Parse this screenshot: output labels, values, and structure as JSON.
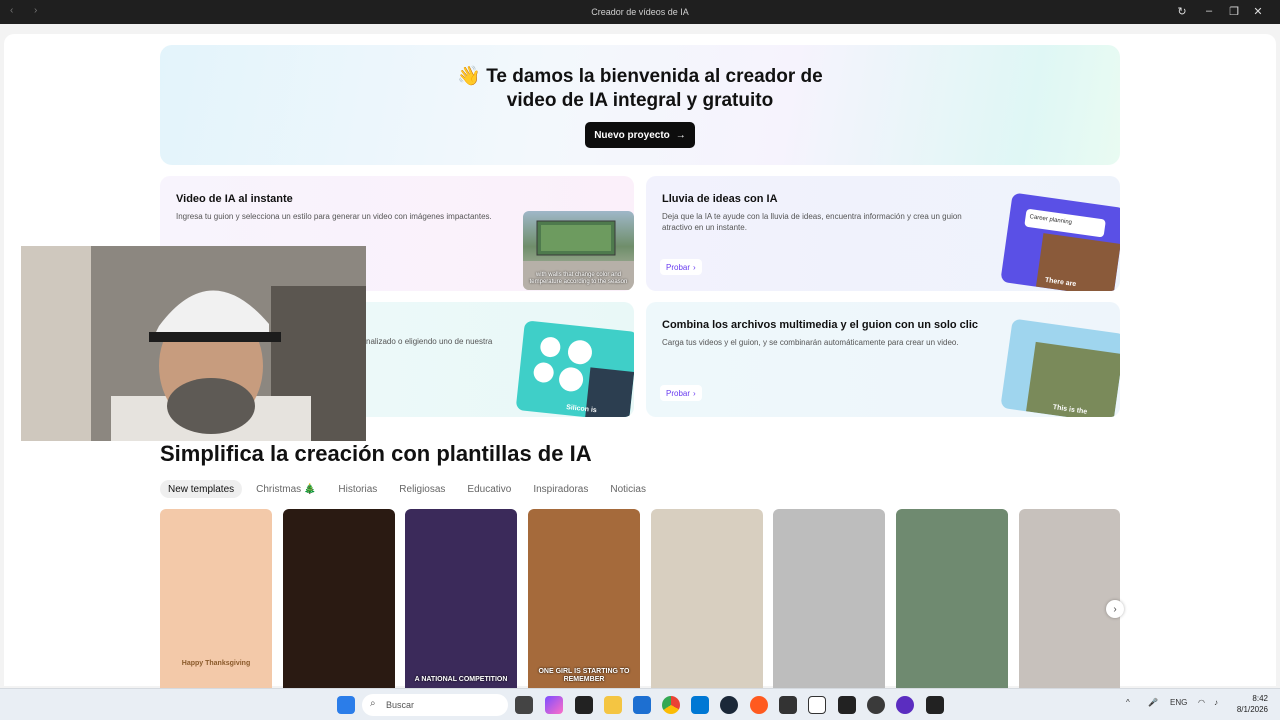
{
  "window": {
    "title": "Creador de vídeos de IA"
  },
  "hero": {
    "emoji": "👋",
    "title_line1": "Te damos la bienvenida al creador de",
    "title_line2": "video de IA integral y gratuito",
    "button_label": "Nuevo proyecto"
  },
  "cards": [
    {
      "title": "Video de IA al instante",
      "desc": "Ingresa tu guion y selecciona un estilo para generar un video con imágenes impactantes.",
      "thumb_caption": "with walls that change color and temperature according to the season"
    },
    {
      "title": "Lluvia de ideas con IA",
      "desc": "Deja que la IA te ayude con la lluvia de ideas, encuentra información y crea un guion atractivo en un instante.",
      "button": "Probar",
      "thumb_chip": "Career planning",
      "thumb_caption": "There are"
    },
    {
      "desc_partial": "nalizado o eligiendo uno de nuestra",
      "thumb_caption": "Silicon is"
    },
    {
      "title": "Combina los archivos multimedia y el guion con un solo clic",
      "desc": "Carga tus videos y el guion, y se combinarán automáticamente para crear un video.",
      "button": "Probar",
      "thumb_caption": "This is the"
    }
  ],
  "templates_section": {
    "title": "Simplifica la creación con plantillas de IA",
    "tabs": [
      "New templates",
      "Christmas 🎄",
      "Historias",
      "Religiosas",
      "Educativo",
      "Inspiradoras",
      "Noticias"
    ],
    "active_tab": "New templates",
    "items": [
      {
        "caption": "Happy Thanksgiving",
        "color": "#f3c9a9"
      },
      {
        "caption": "",
        "color": "#2a1a12"
      },
      {
        "caption": "A NATIONAL COMPETITION",
        "color": "#3b2a5a"
      },
      {
        "caption": "ONE GIRL IS STARTING TO REMEMBER",
        "color": "#a56a3b"
      },
      {
        "caption": "",
        "color": "#d8cfc0"
      },
      {
        "caption": "",
        "color": "#bdbdbd"
      },
      {
        "caption": "",
        "color": "#6f8a70"
      },
      {
        "caption": "",
        "color": "#c7c1bc"
      }
    ]
  },
  "taskbar": {
    "search_placeholder": "Buscar",
    "language": "ENG",
    "time": "8:42",
    "date": "8/1/2026"
  }
}
